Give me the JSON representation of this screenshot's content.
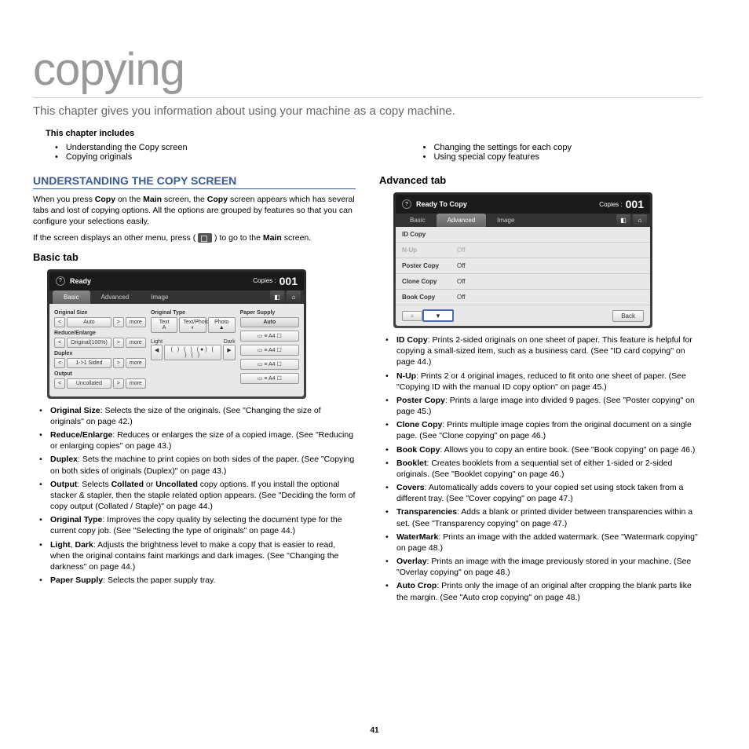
{
  "title": "copying",
  "intro": "This chapter gives you information about using your machine as a copy machine.",
  "includes_heading": "This chapter includes",
  "includes_left": [
    "Understanding the Copy screen",
    "Copying originals"
  ],
  "includes_right": [
    "Changing the settings for each copy",
    "Using special copy features"
  ],
  "section1": {
    "heading": "UNDERSTANDING THE COPY SCREEN",
    "p1_a": "When you press ",
    "p1_b": "Copy",
    "p1_c": " on the ",
    "p1_d": "Main",
    "p1_e": " screen, the ",
    "p1_f": "Copy",
    "p1_g": " screen appears which has several tabs and lost of copying options. All the options are grouped by features so that you can configure your selections easily.",
    "p2_a": "If the screen displays an other menu, press ( ",
    "p2_b": " ) to go to the ",
    "p2_c": "Main",
    "p2_d": " screen."
  },
  "basic": {
    "heading": "Basic tab",
    "ss": {
      "status": "Ready",
      "copies_label": "Copies :",
      "copies_num": "001",
      "tabs": [
        "Basic",
        "Advanced",
        "Image"
      ],
      "labels": {
        "orig_size": "Original Size",
        "auto": "Auto",
        "more": "more",
        "reduce": "Reduce/Enlarge",
        "orig100": "Original(100%)",
        "duplex": "Duplex",
        "sided": "1->1 Sided",
        "output": "Output",
        "uncollated": "Uncollated",
        "orig_type": "Original Type",
        "text": "Text",
        "textphoto": "Text/Photo",
        "photo": "Photo",
        "light": "Light",
        "dark": "Dark",
        "paper": "Paper Supply"
      }
    },
    "items": [
      {
        "t": "Original Size",
        "d": ": Selects the size of the originals. (See \"Changing the size of originals\" on page 42.)"
      },
      {
        "t": "Reduce/Enlarge",
        "d": ": Reduces or enlarges the size of a copied image. (See \"Reducing or enlarging copies\" on page 43.)"
      },
      {
        "t": "Duplex",
        "d": ": Sets the machine to print copies on both sides of the paper. (See \"Copying on both sides of originals (Duplex)\" on page 43.)"
      },
      {
        "t": "Output",
        "d": ": Selects <b>Collated</b> or <b>Uncollated</b> copy options. If you install the optional stacker & stapler, then the staple related option appears. (See \"Deciding the form of copy output (Collated / Staple)\" on page 44.)"
      },
      {
        "t": "Original Type",
        "d": ": Improves the copy quality by selecting the document type for the current copy job. (See \"Selecting the type of originals\" on page 44.)"
      },
      {
        "t": "Light",
        "d": ", <b>Dark</b>: Adjusts the brightness level to make a copy that is easier to read, when the original contains faint markings and dark images. (See \"Changing the darkness\" on page 44.)"
      },
      {
        "t": "Paper Supply",
        "d": ": Selects the paper supply tray."
      }
    ]
  },
  "advanced": {
    "heading": "Advanced tab",
    "ss": {
      "status": "Ready To Copy",
      "copies_label": "Copies :",
      "copies_num": "001",
      "rows": [
        {
          "l": "ID Copy",
          "v": "",
          "dis": false
        },
        {
          "l": "N-Up",
          "v": "Off",
          "dis": true
        },
        {
          "l": "Poster Copy",
          "v": "Off",
          "dis": false
        },
        {
          "l": "Clone Copy",
          "v": "Off",
          "dis": false
        },
        {
          "l": "Book Copy",
          "v": "Off",
          "dis": false
        }
      ],
      "back": "Back"
    },
    "items": [
      {
        "t": "ID Copy",
        "d": ": Prints 2-sided originals on one sheet of paper. This feature is helpful for copying a small-sized item, such as a business card. (See \"ID card copying\" on page 44.)"
      },
      {
        "t": "N-Up",
        "d": ": Prints 2 or 4 original images, reduced to fit onto one sheet of paper. (See \"Copying ID with the manual ID copy option\" on page 45.)"
      },
      {
        "t": "Poster Copy",
        "d": ": Prints a large image into divided 9 pages. (See \"Poster copying\" on page 45.)"
      },
      {
        "t": "Clone Copy",
        "d": ": Prints multiple image copies from the original document on a single page. (See \"Clone copying\" on page 46.)"
      },
      {
        "t": "Book Copy",
        "d": ": Allows you to copy an entire book. (See \"Book copying\" on page 46.)"
      },
      {
        "t": "Booklet",
        "d": ": Creates booklets from a sequential set of either 1-sided or 2-sided originals. (See \"Booklet copying\" on page 46.)"
      },
      {
        "t": "Covers",
        "d": ": Automatically adds covers to your copied set using stock taken from a different tray. (See \"Cover copying\" on page 47.)"
      },
      {
        "t": "Transparencies",
        "d": ": Adds a blank or printed divider between transparencies within a set. (See \"Transparency copying\" on page 47.)"
      },
      {
        "t": "WaterMark",
        "d": ": Prints an image with the added watermark. (See \"Watermark copying\" on page 48.)"
      },
      {
        "t": "Overlay",
        "d": ": Prints an image with the image previously stored in your machine. (See \"Overlay copying\" on page 48.)"
      },
      {
        "t": "Auto Crop",
        "d": ": Prints only the image of an original after cropping the blank parts like the margin. (See \"Auto crop copying\" on page 48.)"
      }
    ]
  },
  "page_num": "41"
}
